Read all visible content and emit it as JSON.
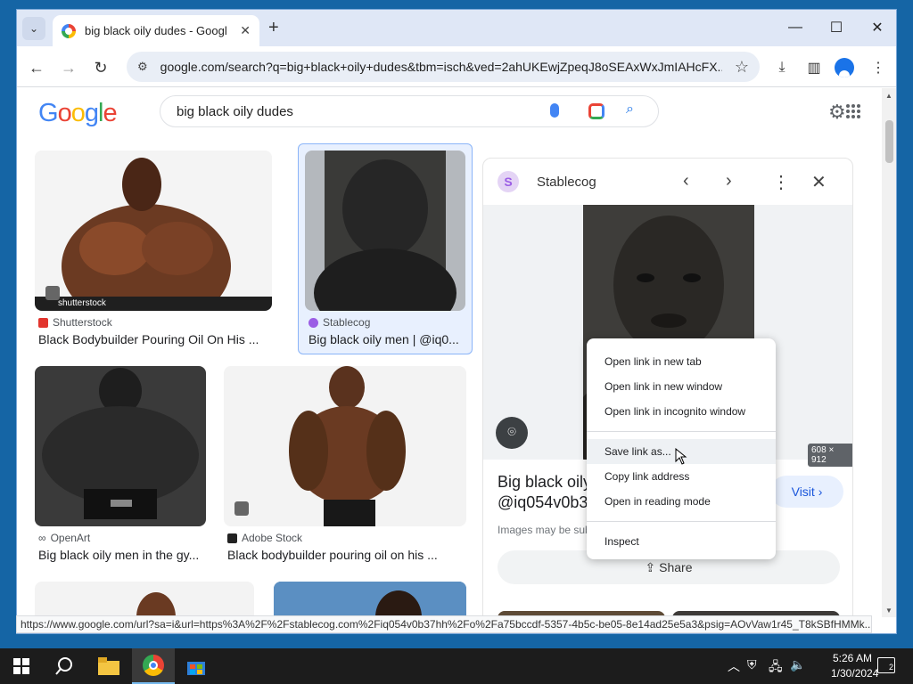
{
  "browser": {
    "tab_title": "big black oily dudes - Google S",
    "tab_close": "✕",
    "new_tab": "+",
    "url": "google.com/search?q=big+black+oily+dudes&tbm=isch&ved=2ahUKEwjZpeqJ8oSEAxWxJmIAHcFX..."
  },
  "google": {
    "logo": [
      "G",
      "o",
      "o",
      "g",
      "l",
      "e"
    ],
    "query": "big black oily dudes"
  },
  "results": [
    {
      "source": "Shutterstock",
      "title": "Black Bodybuilder Pouring Oil On His ...",
      "watermark": "shutterstock",
      "source_color": "#e2352e"
    },
    {
      "source": "Stablecog",
      "title": "Big black oily men | @iq0...",
      "source_color": "#9b5de5"
    },
    {
      "source": "OpenArt",
      "title": "Big black oily men in the gy...",
      "source_color": "#333333"
    },
    {
      "source": "Adobe Stock",
      "title": "Black bodybuilder pouring oil on his ...",
      "source_color": "#333333"
    }
  ],
  "panel": {
    "source_name": "Stablecog",
    "image_dims": "608 × 912",
    "title_line1": "Big black oily",
    "title_line2": "@iq054v0b3",
    "visit_label": "Visit",
    "copyright": "Images may be sub",
    "share_label": "Share"
  },
  "context_menu": {
    "items_top": [
      "Open link in new tab",
      "Open link in new window",
      "Open link in incognito window"
    ],
    "items_mid": [
      "Save link as...",
      "Copy link address",
      "Open in reading mode"
    ],
    "items_bottom": [
      "Inspect"
    ]
  },
  "status_url": "https://www.google.com/url?sa=i&url=https%3A%2F%2Fstablecog.com%2Fiq054v0b37hh%2Fo%2Fa75bccdf-5357-4b5c-be05-8e14ad25e5a3&psig=AOvVaw1r45_T8kSBfHMMk...",
  "taskbar": {
    "time": "5:26 AM",
    "date": "1/30/2024",
    "notification_count": "2"
  },
  "colors": {
    "accent": "#1a73e8",
    "tab_strip": "#dfe7f6"
  }
}
